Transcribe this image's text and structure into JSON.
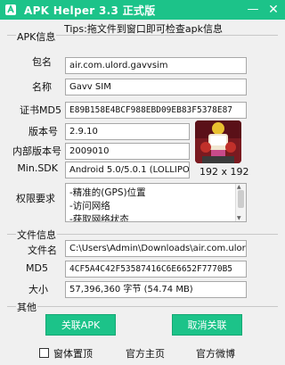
{
  "window": {
    "title": "APK Helper 3.3 正式版",
    "minimize_glyph": "—",
    "close_glyph": "✕"
  },
  "apk_info": {
    "section_title": "APK信息",
    "tips": "Tips:拖文件到窗口即可检查apk信息",
    "package_label": "包名",
    "package_value": "air.com.ulord.gavvsim",
    "name_label": "名称",
    "name_value": "Gavv SIM",
    "cert_label": "证书MD5",
    "cert_value": "E89B158E4BCF988EBD09EB83F5378E87",
    "version_label": "版本号",
    "version_value": "2.9.10",
    "internal_version_label": "内部版本号",
    "internal_version_value": "2009010",
    "min_sdk_label": "Min.SDK",
    "min_sdk_value": "Android 5.0/5.0.1 (LOLLIPOP)",
    "icon_size": "192 x 192",
    "permissions_label": "权限要求",
    "permissions": [
      "-精准的(GPS)位置",
      "-访问网络",
      "-获取网络状态"
    ]
  },
  "file_info": {
    "section_title": "文件信息",
    "filename_label": "文件名",
    "filename_value": "C:\\Users\\Admin\\Downloads\\air.com.ulord.gavv",
    "md5_label": "MD5",
    "md5_value": "4CF5A4C42F53587416C6E6652F7770B5",
    "size_label": "大小",
    "size_value": "57,396,360 字节 (54.74 MB)"
  },
  "other": {
    "section_title": "其他",
    "associate_button": "关联APK",
    "unassociate_button": "取消关联",
    "always_on_top_label": "窗体置顶",
    "homepage_link": "官方主页",
    "weibo_link": "官方微博"
  },
  "colors": {
    "accent": "#1cc389",
    "window_bg": "#f0f0f0"
  }
}
